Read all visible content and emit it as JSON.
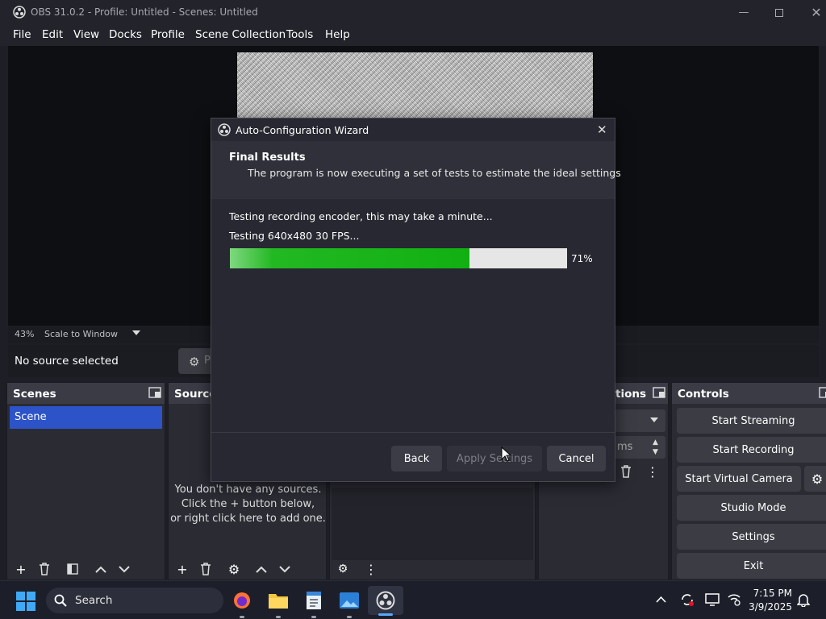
{
  "window": {
    "title": "OBS 31.0.2 - Profile: Untitled - Scenes: Untitled"
  },
  "menu": [
    "File",
    "Edit",
    "View",
    "Docks",
    "Profile",
    "Scene Collection",
    "Tools",
    "Help"
  ],
  "preview": {
    "zoom": "43%",
    "scale_mode": "Scale to Window"
  },
  "source_bar": {
    "no_source": "No source selected",
    "properties_partial": "P"
  },
  "scenes": {
    "title": "Scenes",
    "items": [
      "Scene"
    ]
  },
  "sources": {
    "title": "Sources",
    "empty_text_1": "You don't have any sources.",
    "empty_text_2": "Click the + button below,",
    "empty_text_3": "or right click here to add one."
  },
  "transitions": {
    "title_partial": "tions",
    "duration_partial": "ms"
  },
  "controls": {
    "title": "Controls",
    "buttons": [
      "Start Streaming",
      "Start Recording",
      "Start Virtual Camera",
      "Studio Mode",
      "Settings",
      "Exit"
    ]
  },
  "dialog": {
    "title": "Auto-Configuration Wizard",
    "heading": "Final Results",
    "subheading": "The program is now executing a set of tests to estimate the ideal settings",
    "status": "Testing recording encoder, this may take a minute...",
    "test": "Testing 640x480 30 FPS...",
    "progress": 0.71,
    "progress_label": "71%",
    "buttons": {
      "back": "Back",
      "apply": "Apply Settings",
      "cancel": "Cancel"
    }
  },
  "taskbar": {
    "search_placeholder": "Search",
    "time": "7:15 PM",
    "date": "3/9/2025"
  },
  "colors": {
    "accent_scene": "#2d53c9",
    "progress_fill": "#11b011"
  }
}
